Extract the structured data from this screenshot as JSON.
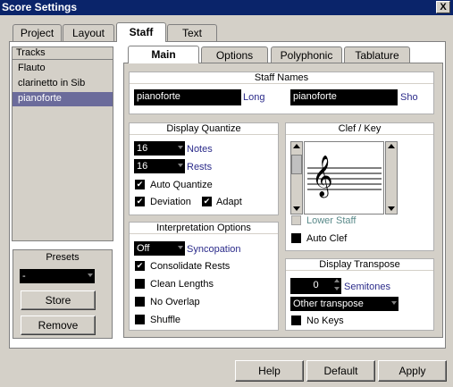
{
  "window": {
    "title": "Score Settings",
    "close_glyph": "X"
  },
  "top_tabs": [
    {
      "label": "Project"
    },
    {
      "label": "Layout"
    },
    {
      "label": "Staff"
    },
    {
      "label": "Text"
    }
  ],
  "tracks": {
    "header": "Tracks",
    "items": [
      "Flauto",
      "clarinetto in Sib",
      "pianoforte"
    ],
    "selected": "pianoforte"
  },
  "presets": {
    "header": "Presets",
    "value": "-",
    "store_label": "Store",
    "remove_label": "Remove"
  },
  "sub_tabs": [
    {
      "label": "Main"
    },
    {
      "label": "Options"
    },
    {
      "label": "Polyphonic"
    },
    {
      "label": "Tablature"
    }
  ],
  "staff_names": {
    "title": "Staff Names",
    "long_value": "pianoforte",
    "long_label": "Long",
    "short_value": "pianoforte",
    "short_label": "Sho"
  },
  "display_quantize": {
    "title": "Display Quantize",
    "notes_value": "16",
    "notes_label": "Notes",
    "rests_value": "16",
    "rests_label": "Rests",
    "auto_quantize": "Auto Quantize",
    "deviation": "Deviation",
    "adapt": "Adapt"
  },
  "interpretation": {
    "title": "Interpretation Options",
    "syncopation_value": "Off",
    "syncopation_label": "Syncopation",
    "consolidate_rests": "Consolidate Rests",
    "clean_lengths": "Clean Lengths",
    "no_overlap": "No Overlap",
    "shuffle": "Shuffle"
  },
  "clef_key": {
    "title": "Clef / Key",
    "clef_glyph": "𝄞",
    "lower_staff": "Lower Staff",
    "auto_clef": "Auto Clef"
  },
  "display_transpose": {
    "title": "Display Transpose",
    "semitones_value": "0",
    "semitones_label": "Semitones",
    "transpose_value": "Other transpose",
    "no_keys": "No Keys"
  },
  "footer": {
    "help": "Help",
    "default": "Default",
    "apply": "Apply"
  },
  "check_glyph": "✔"
}
